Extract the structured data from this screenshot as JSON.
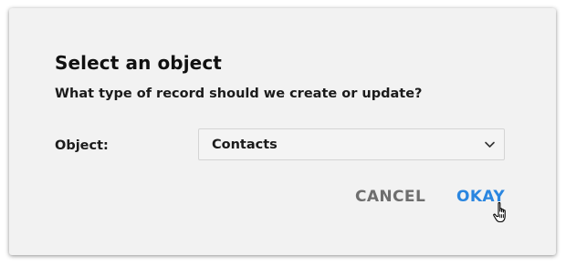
{
  "dialog": {
    "title": "Select an object",
    "subtitle": "What type of record should we create or update?",
    "field_label": "Object:",
    "select": {
      "value": "Contacts",
      "icon": "chevron-down-icon"
    },
    "buttons": {
      "cancel_label": "CANCEL",
      "okay_label": "OKAY"
    }
  },
  "colors": {
    "dialog_bg": "#f2f2f2",
    "cancel_text": "#6e6e6e",
    "okay_text": "#2a86e0"
  },
  "cursor_icon": "hand-pointer-icon"
}
